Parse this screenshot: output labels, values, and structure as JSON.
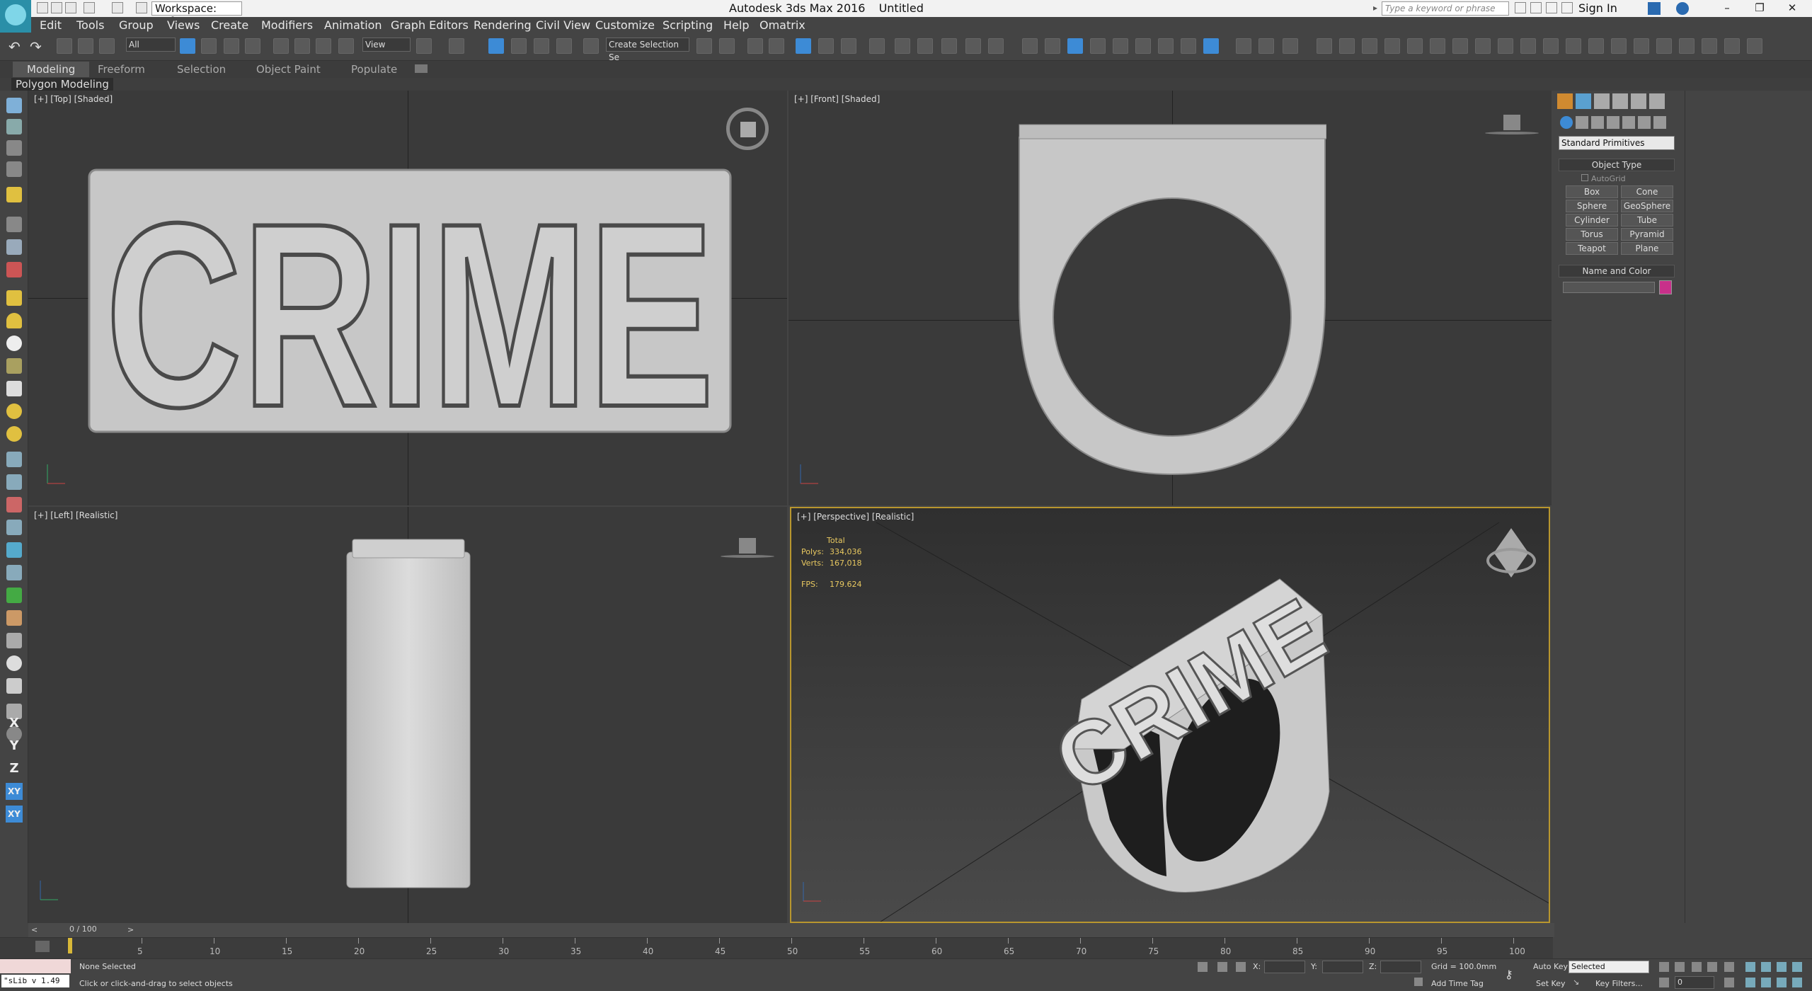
{
  "app": {
    "title": "Autodesk 3ds Max 2016",
    "doc": "Untitled",
    "workspace": "Workspace: Defa",
    "search_placeholder": "Type a keyword or phrase",
    "signin": "Sign In"
  },
  "menu": [
    "Edit",
    "Tools",
    "Group",
    "Views",
    "Create",
    "Modifiers",
    "Animation",
    "Graph Editors",
    "Rendering",
    "Civil View",
    "Customize",
    "Scripting",
    "Help",
    "Omatrix"
  ],
  "toolbar": {
    "filter": "All",
    "refcoord": "View",
    "selection_set": "Create Selection Se"
  },
  "ribbon": {
    "tabs": [
      "Modeling",
      "Freeform",
      "Selection",
      "Object Paint",
      "Populate"
    ],
    "sub": "Polygon Modeling"
  },
  "viewports": {
    "top": "[+] [Top] [Shaded]",
    "front": "[+] [Front] [Shaded]",
    "left": "[+] [Left] [Realistic]",
    "persp": "[+] [Perspective] [Realistic]",
    "model_text": "CRIME",
    "stats": {
      "total": "Total",
      "polys_label": "Polys:",
      "polys": "334,036",
      "verts_label": "Verts:",
      "verts": "167,018",
      "fps_label": "FPS:",
      "fps": "179.624"
    }
  },
  "panel": {
    "dropdown": "Standard Primitives",
    "object_type": "Object Type",
    "autogrid": "AutoGrid",
    "buttons": [
      "Box",
      "Cone",
      "Sphere",
      "GeoSphere",
      "Cylinder",
      "Tube",
      "Torus",
      "Pyramid",
      "Teapot",
      "Plane"
    ],
    "name_color": "Name and Color",
    "color": "#c8308a"
  },
  "timeline": {
    "frame": "0 / 100",
    "ticks": [
      "5",
      "10",
      "15",
      "20",
      "25",
      "30",
      "35",
      "40",
      "45",
      "50",
      "55",
      "60",
      "65",
      "70",
      "75",
      "80",
      "85",
      "90",
      "95",
      "100"
    ]
  },
  "status": {
    "script": "\"sLib v 1.49",
    "selected": "None Selected",
    "prompt": "Click or click-and-drag to select objects",
    "x": "X:",
    "y": "Y:",
    "z": "Z:",
    "grid": "Grid = 100.0mm",
    "autokey": "Auto Key",
    "autokey_value": "Selected",
    "setkey": "Set Key",
    "keyfilters": "Key Filters...",
    "addtimetag": "Add Time Tag",
    "frame_field": "0"
  }
}
